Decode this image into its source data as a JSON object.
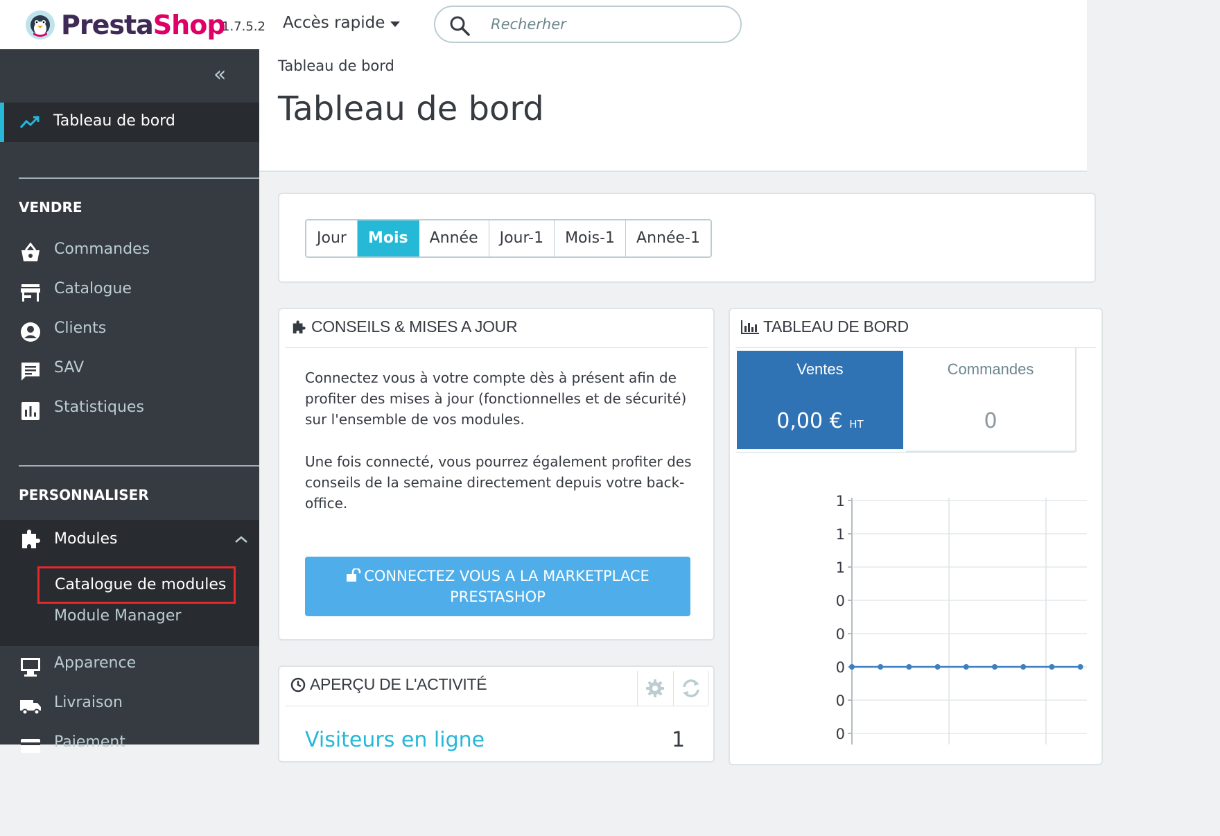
{
  "header": {
    "logo_part1": "Presta",
    "logo_part2": "Shop",
    "version": "1.7.5.2",
    "quick_access": "Accès rapide",
    "search_placeholder": "Recherher"
  },
  "sidebar": {
    "active_item": "Tableau de bord",
    "sections": {
      "sell": "VENDRE",
      "customize": "PERSONNALISER"
    },
    "sell_items": [
      {
        "label": "Commandes",
        "icon": "basket-icon"
      },
      {
        "label": "Catalogue",
        "icon": "store-icon"
      },
      {
        "label": "Clients",
        "icon": "user-circle-icon"
      },
      {
        "label": "SAV",
        "icon": "chat-icon"
      },
      {
        "label": "Statistiques",
        "icon": "bar-chart-icon"
      }
    ],
    "modules": {
      "label": "Modules",
      "sub": [
        "Catalogue de modules",
        "Module Manager"
      ]
    },
    "customize_items": [
      {
        "label": "Apparence",
        "icon": "monitor-icon"
      },
      {
        "label": "Livraison",
        "icon": "truck-icon"
      },
      {
        "label": "Paiement",
        "icon": "card-icon"
      }
    ]
  },
  "main": {
    "breadcrumb": "Tableau de bord",
    "title": "Tableau de bord",
    "periods": [
      "Jour",
      "Mois",
      "Année",
      "Jour-1",
      "Mois-1",
      "Année-1"
    ],
    "active_period": "Mois",
    "tips": {
      "title": "CONSEILS & MISES A JOUR",
      "p1": "Connectez vous à votre compte dès à présent afin de profiter des mises à jour (fonctionnelles et de sécurité) sur l'ensemble de vos modules.",
      "p2": "Une fois connecté, vous pourrez également profiter des conseils de la semaine directement depuis votre back-office.",
      "button_line1": "CONNECTEZ VOUS A LA MARKETPLACE",
      "button_line2": "PRESTASHOP"
    },
    "activity": {
      "title": "APERÇU DE L'ACTIVITÉ",
      "visitors_label": "Visiteurs en ligne",
      "visitors_count": "1"
    },
    "dashboard": {
      "title": "TABLEAU DE BORD",
      "kpi_sales_title": "Ventes",
      "kpi_sales_value": "0,00 €",
      "kpi_sales_suffix": "HT",
      "kpi_orders_title": "Commandes",
      "kpi_orders_value": "0"
    }
  },
  "chart_data": {
    "type": "line",
    "y_tick_labels": [
      "1",
      "1",
      "1",
      "0",
      "0",
      "0",
      "0",
      "0"
    ],
    "series": [
      {
        "values": [
          0,
          0,
          0,
          0,
          0,
          0,
          0,
          0,
          0
        ]
      }
    ],
    "colors": {
      "line": "#3d7fc0",
      "grid": "#dde4e6"
    }
  },
  "colors": {
    "sidebar_bg": "#363a41",
    "sidebar_active": "#282b30",
    "accent": "#25b9d7",
    "kpi_active": "#3073b4",
    "marketplace_button": "#4faee9",
    "highlight_border": "#e5282b"
  }
}
